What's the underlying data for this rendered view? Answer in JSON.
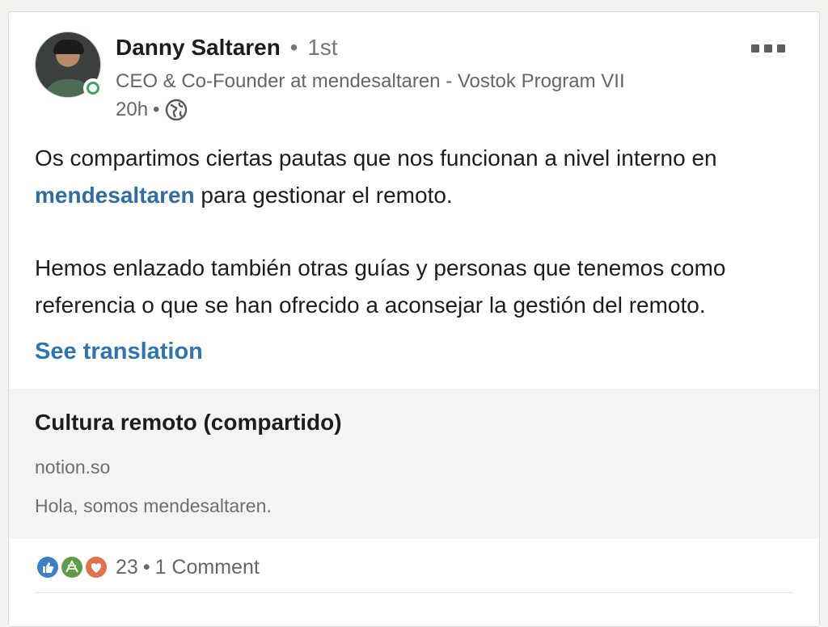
{
  "post": {
    "author": {
      "name": "Danny Saltaren",
      "degree_separator": "•",
      "degree": "1st",
      "headline": "CEO & Co-Founder at mendesaltaren - Vostok Program VII",
      "time": "20h",
      "time_separator": "•",
      "visibility_icon": "globe-icon",
      "presence_status": "online"
    },
    "more_icon": "more-horizontal-icon",
    "text": {
      "p1_before": "Os compartimos ciertas pautas que nos funcionan a nivel interno en ",
      "p1_mention": "mendesaltaren",
      "p1_after": " para gestionar el remoto.",
      "p2": "Hemos enlazado también otras guías y personas que tenemos como referencia o que se han ofrecido a aconsejar la gestión del remoto."
    },
    "see_translation": "See translation",
    "link_preview": {
      "title": "Cultura remoto (compartido)",
      "domain": "notion.so",
      "description": "Hola, somos mendesaltaren."
    },
    "social": {
      "reaction_icons": [
        "like-icon",
        "celebrate-icon",
        "love-icon"
      ],
      "reaction_count": "23",
      "separator": "•",
      "comments": "1 Comment"
    }
  },
  "colors": {
    "link_blue": "#2f73b0",
    "presence_green": "#46a35e",
    "muted_text": "#666666"
  }
}
